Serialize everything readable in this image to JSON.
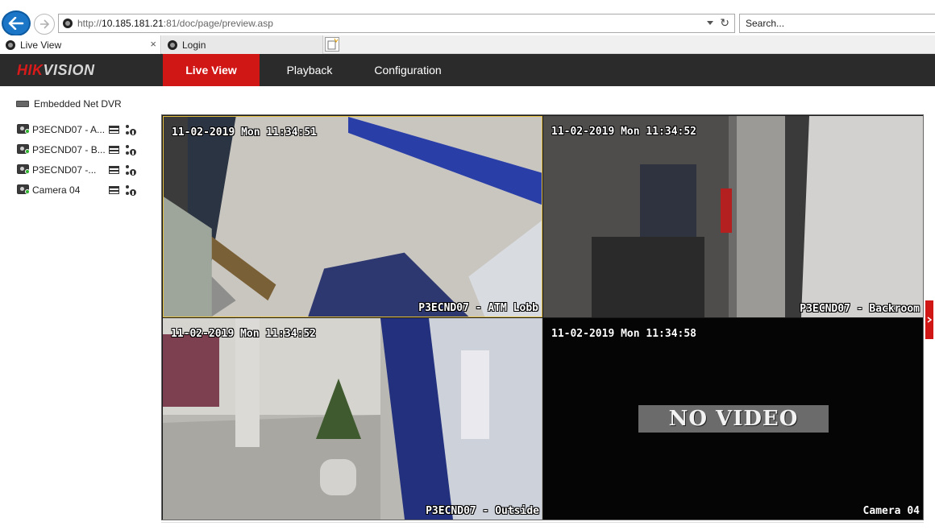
{
  "browser": {
    "url_prefix": "http://",
    "url_host": "10.185.181.21",
    "url_rest": ":81/doc/page/preview.asp",
    "search_placeholder": "Search...",
    "tabs": [
      {
        "label": "Live View",
        "active": true
      },
      {
        "label": "Login",
        "active": false
      }
    ],
    "close_glyph": "×"
  },
  "app": {
    "logo_red": "HIK",
    "logo_rest": "VISION",
    "nav": [
      {
        "label": "Live View",
        "active": true
      },
      {
        "label": "Playback",
        "active": false
      },
      {
        "label": "Configuration",
        "active": false
      }
    ],
    "accent_color": "#d11616"
  },
  "device_tree": {
    "device_name": "Embedded Net DVR",
    "cameras": [
      {
        "label": "P3ECND07 - A...",
        "online": true
      },
      {
        "label": "P3ECND07 - B...",
        "online": true
      },
      {
        "label": "P3ECND07 -...",
        "online": true
      },
      {
        "label": "Camera 04",
        "online": true
      }
    ]
  },
  "video_grid": {
    "tiles": [
      {
        "timestamp": "11-02-2019 Mon 11:34:51",
        "channel_name": "P3ECND07 - ATM Lobb",
        "selected": true
      },
      {
        "timestamp": "11-02-2019 Mon 11:34:52",
        "channel_name": "P3ECND07 - Backroom",
        "selected": false
      },
      {
        "timestamp": "11-02-2019 Mon 11:34:52",
        "channel_name": "P3ECND07 - Outside",
        "selected": false
      },
      {
        "timestamp": "11-02-2019 Mon 11:34:58",
        "channel_name": "Camera 04",
        "selected": false,
        "no_video_text": "NO VIDEO"
      }
    ]
  },
  "icons": {
    "back": "back-arrow-icon",
    "forward": "forward-arrow-icon",
    "refresh": "refresh-icon",
    "camera": "camera-icon",
    "record": "record-icon",
    "ptz": "ptz-icon",
    "dvr": "dvr-icon"
  }
}
